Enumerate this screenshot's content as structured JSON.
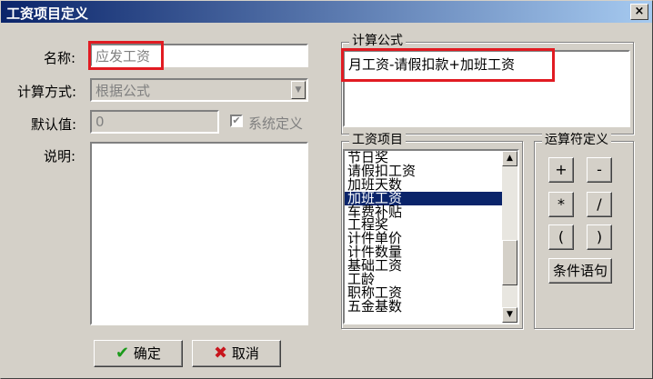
{
  "window": {
    "title": "工资项目定义",
    "close_label": "×"
  },
  "form": {
    "name_label": "名称:",
    "name_value": "应发工资",
    "calc_label": "计算方式:",
    "calc_value": "根据公式",
    "default_label": "默认值:",
    "default_value": "0",
    "system_label": "系统定义",
    "desc_label": "说明:"
  },
  "formula": {
    "group_title": "计算公式",
    "value": "月工资-请假扣款+加班工资"
  },
  "items": {
    "group_title": "工资项目",
    "list": [
      "节日奖",
      "请假扣工资",
      "加班天数",
      "加班工资",
      "车费补贴",
      "工程奖",
      "计件单价",
      "计件数量",
      "基础工资",
      "工龄",
      "职称工资",
      "五金基数"
    ],
    "selected_index": 3
  },
  "operators": {
    "group_title": "运算符定义",
    "buttons": [
      "+",
      "-",
      "*",
      "/",
      "(",
      ")"
    ],
    "condition_label": "条件语句"
  },
  "actions": {
    "ok_label": "确定",
    "cancel_label": "取消"
  },
  "colors": {
    "highlight": "#e11b22",
    "selection": "#0a246a",
    "ok_icon": "#1a9a1a",
    "cancel_icon": "#c8161d"
  }
}
